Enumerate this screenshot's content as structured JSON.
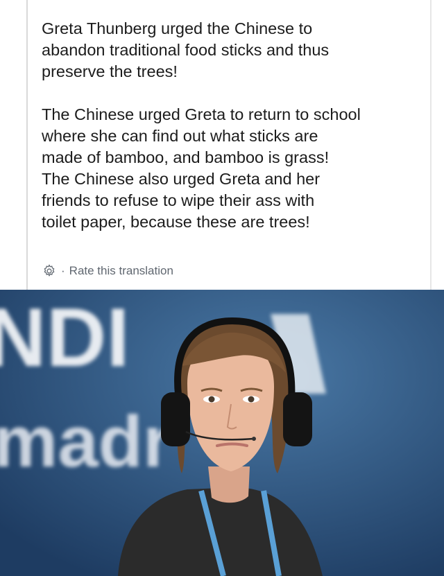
{
  "post": {
    "paragraphs": [
      [
        "Greta Thunberg urged the Chinese to",
        "abandon traditional food sticks and thus",
        "preserve the trees!"
      ],
      [
        "The Chinese urged Greta to return to school",
        "where she can find out what sticks are",
        "made of bamboo, and bamboo is grass!",
        "The Chinese also urged Greta and her",
        "friends to refuse to wipe their ass with",
        "toilet paper, because these are trees!"
      ]
    ],
    "separator": "·",
    "rate_label": "Rate this translation",
    "gear_icon": "gear-icon"
  },
  "photo": {
    "backdrop_letters_top": "NDI",
    "backdrop_letters_bottom": "madr",
    "colors": {
      "backdrop": "#2b5584",
      "letters": "#ffffff",
      "shirt": "#2a2a2a",
      "hair": "#6b4a2e",
      "skin": "#e8b79b",
      "headphones": "#111111",
      "lanyard": "#5aa0d6"
    }
  }
}
